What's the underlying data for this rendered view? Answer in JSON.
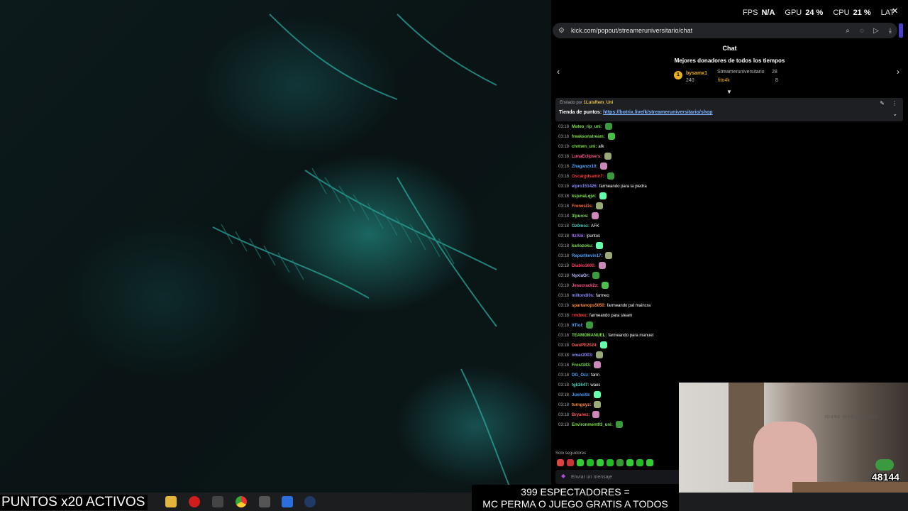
{
  "overlay_stats": [
    {
      "key": "FPS",
      "value": "N/A"
    },
    {
      "key": "GPU",
      "value": "24 %"
    },
    {
      "key": "CPU",
      "value": "21 %"
    },
    {
      "key": "LAT",
      "value": ""
    }
  ],
  "browser": {
    "url": "kick.com/popout/streameruniversitario/chat"
  },
  "chat": {
    "title": "Chat",
    "donors_title": "Mejores donadores de todos los tiempos",
    "donors": [
      {
        "rank": "1",
        "name": "bysamx1",
        "amount": "240"
      },
      {
        "name": "Streameruniversitario",
        "amount": "28"
      },
      {
        "name": "fito4k",
        "amount": "8"
      }
    ],
    "pinned": {
      "sent_by_label": "Enviado por",
      "sender": "1LuisRem_Uni",
      "text": "Tienda de puntos:",
      "link": "https://botrix.live/k/streameruniversitario/shop"
    },
    "messages": [
      {
        "time": "03:18",
        "user": "Mateo_rip_uni:",
        "text": "",
        "color": "#7ee04a"
      },
      {
        "time": "03:18",
        "user": "freaksonstream:",
        "text": "",
        "color": "#7ee04a"
      },
      {
        "time": "03:18",
        "user": "chntwn_uni:",
        "text": "afk",
        "color": "#7ee04a"
      },
      {
        "time": "03:18",
        "user": "LunaEclipse's:",
        "text": "",
        "color": "#ff5a8a"
      },
      {
        "time": "03:18",
        "user": "Zhaganzx10:",
        "text": "",
        "color": "#4aa6ff"
      },
      {
        "time": "03:18",
        "user": "Oscargdsamir7:",
        "text": "",
        "color": "#ff3a3a"
      },
      {
        "time": "03:18",
        "user": "elpro151426:",
        "text": "farmeando para la piedra",
        "color": "#8b8bff"
      },
      {
        "time": "03:18",
        "user": "ksjunaLqjw:",
        "text": "",
        "color": "#7ee04a"
      },
      {
        "time": "03:18",
        "user": "Frenesi1s:",
        "text": "",
        "color": "#ff6a3a"
      },
      {
        "time": "03:18",
        "user": "3lpuros:",
        "text": "",
        "color": "#7ee04a"
      },
      {
        "time": "03:18",
        "user": "Oz0moz:",
        "text": "AFK",
        "color": "#4ad0c0"
      },
      {
        "time": "03:18",
        "user": "ItzAbi:",
        "text": "!puntos",
        "color": "#b26bff"
      },
      {
        "time": "03:18",
        "user": "karlozoku:",
        "text": "",
        "color": "#7ee04a"
      },
      {
        "time": "03:18",
        "user": "Reportkevin17:",
        "text": "",
        "color": "#4aa6ff"
      },
      {
        "time": "03:18",
        "user": "Diablo1600:",
        "text": "",
        "color": "#ff3a6a"
      },
      {
        "time": "03:18",
        "user": "NyxiaOr:",
        "text": "",
        "color": "#b8b8ff"
      },
      {
        "time": "03:18",
        "user": "Jesucrack2z:",
        "text": "",
        "color": "#ff5a8a"
      },
      {
        "time": "03:18",
        "user": "miltondi0s:",
        "text": "farmeo",
        "color": "#8b8bff"
      },
      {
        "time": "03:18",
        "user": "spartanops5050:",
        "text": "farmeando pal maincra",
        "color": "#ff8c3a"
      },
      {
        "time": "03:18",
        "user": "rmdeez:",
        "text": "farmeando para steam",
        "color": "#ff3a3a"
      },
      {
        "time": "03:18",
        "user": "ItTiol:",
        "text": "",
        "color": "#4aa6ff"
      },
      {
        "time": "03:18",
        "user": "TEAMOMANUEL:",
        "text": "farmeando para manuel",
        "color": "#7ee04a"
      },
      {
        "time": "03:18",
        "user": "DaniPE2024:",
        "text": "",
        "color": "#ff5a5a"
      },
      {
        "time": "03:18",
        "user": "omar2003:",
        "text": "",
        "color": "#8b8bff"
      },
      {
        "time": "03:18",
        "user": "Frost343:",
        "text": "",
        "color": "#7ee04a"
      },
      {
        "time": "03:18",
        "user": "DG_Ozz:",
        "text": "farm",
        "color": "#4aa6ff"
      },
      {
        "time": "03:18",
        "user": "tgk2647:",
        "text": "waos",
        "color": "#4ad0c0"
      },
      {
        "time": "03:18",
        "user": "Juxncito:",
        "text": "",
        "color": "#4aa6ff"
      },
      {
        "time": "03:18",
        "user": "turngoyz:",
        "text": "",
        "color": "#ff8c3a"
      },
      {
        "time": "03:18",
        "user": "Bryanez:",
        "text": "",
        "color": "#ff5a5a"
      },
      {
        "time": "03:18",
        "user": "Environment03_uni:",
        "text": "",
        "color": "#7ee04a"
      }
    ],
    "followers_only": "Solo seguidores",
    "input_placeholder": "Enviar un mensaje"
  },
  "webcam": {
    "viewer_count": "48144",
    "mirror_text": "ddn seuidom seuin"
  },
  "banners": {
    "left": "PUNTOS x20 ACTIVOS",
    "right_line1": "399 ESPECTADORES =",
    "right_line2": "MC PERMA O JUEGO GRATIS A TODOS"
  },
  "taskbar": {
    "icons": [
      "file-explorer-icon",
      "opera-icon",
      "app-icon",
      "chrome-icon",
      "calculator-icon",
      "vscode-icon",
      "steam-icon"
    ]
  }
}
